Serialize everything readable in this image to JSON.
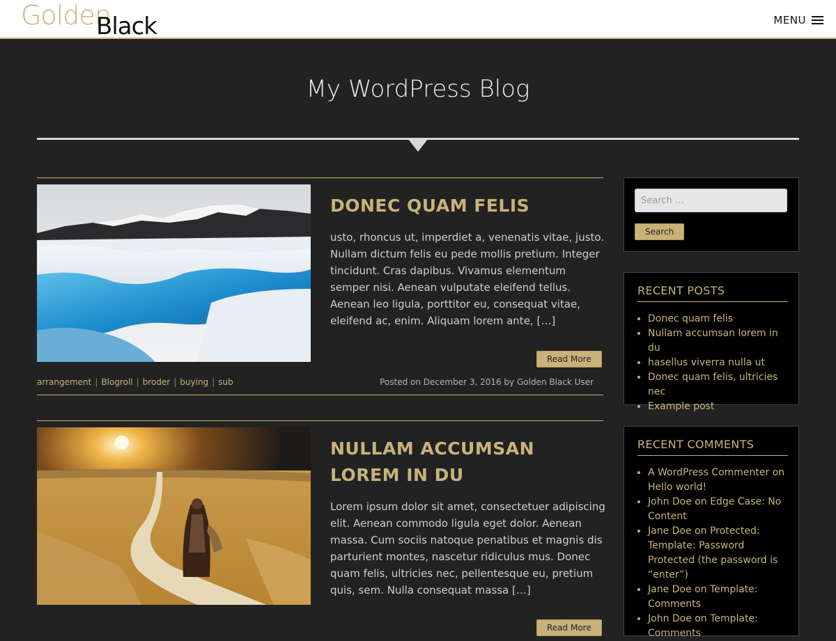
{
  "header": {
    "logo_golden": "Golden",
    "logo_black": "Black",
    "menu_label": "MENU"
  },
  "site": {
    "title": "My WordPress Blog"
  },
  "posts": [
    {
      "title": "DONEC QUAM FELIS",
      "excerpt": "usto, rhoncus ut, imperdiet a, venenatis vitae, justo. Nullam dictum felis eu pede mollis pretium. Integer tincidunt. Cras dapibus. Vivamus elementum semper nisi. Aenean vulputate eleifend tellus. Aenean leo ligula, porttitor eu, consequat vitae, eleifend ac, enim. Aliquam lorem ante,",
      "more": "[…]",
      "read_more": "Read More",
      "tags": [
        "arrangement",
        "Blogroll",
        "broder",
        "buying",
        "sub"
      ],
      "posted": "Posted on December 3, 2016 by Golden Black User"
    },
    {
      "title": "NULLAM ACCUMSAN LOREM IN DU",
      "excerpt": "Lorem ipsum dolor sit amet, consectetuer adipiscing elit. Aenean commodo ligula eget dolor. Aenean massa. Cum sociis natoque penatibus et magnis dis parturient montes, nascetur ridiculus mus. Donec quam felis, ultricies nec, pellentesque eu, pretium quis, sem. Nulla consequat massa",
      "more": "[…]",
      "read_more": "Read More"
    }
  ],
  "sidebar": {
    "search": {
      "placeholder": "Search …",
      "button": "Search"
    },
    "recent_posts": {
      "title": "RECENT POSTS",
      "items": [
        "Donec quam felis",
        "Nullam accumsan lorem in du",
        "hasellus viverra nulla ut",
        "Donec quam felis, ultricies nec",
        "Example post"
      ]
    },
    "recent_comments": {
      "title": "RECENT COMMENTS",
      "items": [
        "A WordPress Commenter on Hello world!",
        "John Doe on Edge Case: No Content",
        "Jane Doe on Protected: Template: Password Protected (the password is “enter”)",
        "Jane Doe on Template: Comments",
        "John Doe on Template: Comments"
      ]
    }
  },
  "colors": {
    "accent": "#c9b27a",
    "background": "#222222",
    "widget_bg": "#000000"
  }
}
